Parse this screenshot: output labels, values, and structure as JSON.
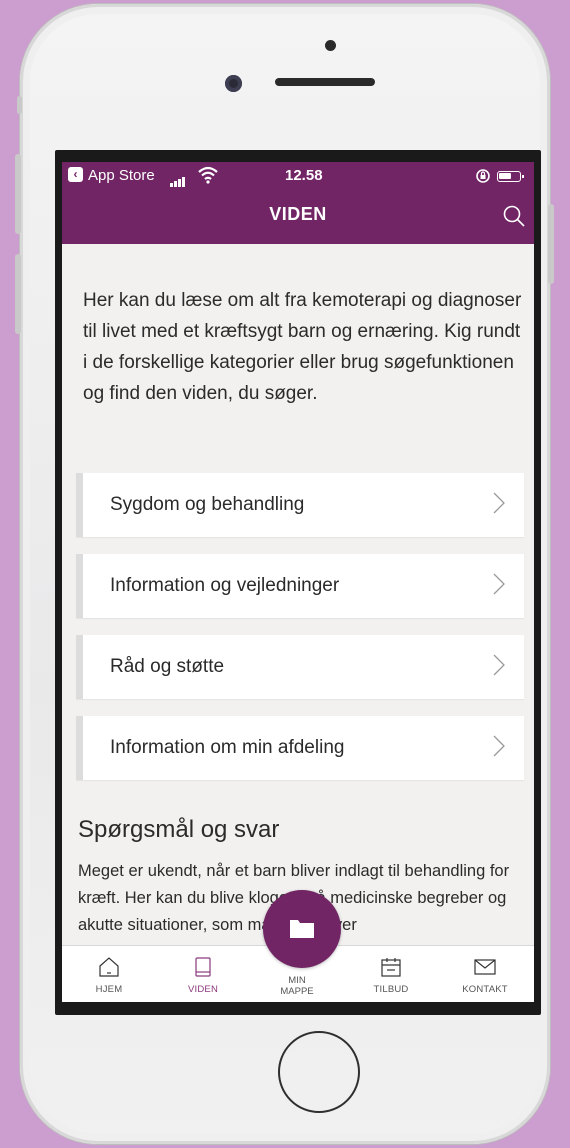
{
  "statusbar": {
    "back_app": "App Store",
    "time": "12.58"
  },
  "header": {
    "title": "VIDEN"
  },
  "intro": "Her kan du læse om alt fra kemoterapi og diagnoser til livet med et kræftsygt barn og ernæring. Kig rundt i de forskellige kategorier eller brug søgefunktionen og find den viden, du søger.",
  "categories": [
    {
      "label": "Sygdom og behandling"
    },
    {
      "label": "Information og vejledninger"
    },
    {
      "label": "Råd og støtte"
    },
    {
      "label": "Information om min afdeling"
    }
  ],
  "qa": {
    "title": "Spørgsmål og svar",
    "text": "Meget er ukendt, når et barn bliver indlagt til behandling for kræft. Her kan du blive klogere på medicinske begreber og akutte situationer, som mange oplever"
  },
  "tabbar": {
    "home": "HJEM",
    "viden": "VIDEN",
    "mappe_line1": "MIN",
    "mappe_line2": "MAPPE",
    "tilbud": "TILBUD",
    "kontakt": "KONTAKT"
  },
  "colors": {
    "brand": "#722565",
    "active_tab": "#8a3a7d",
    "background": "#cc9ecf"
  },
  "icons": {
    "search": "search-icon",
    "chevron": "chevron-right-icon",
    "home": "home-icon",
    "book": "book-icon",
    "folder": "folder-icon",
    "calendar": "calendar-icon",
    "mail": "mail-icon"
  }
}
